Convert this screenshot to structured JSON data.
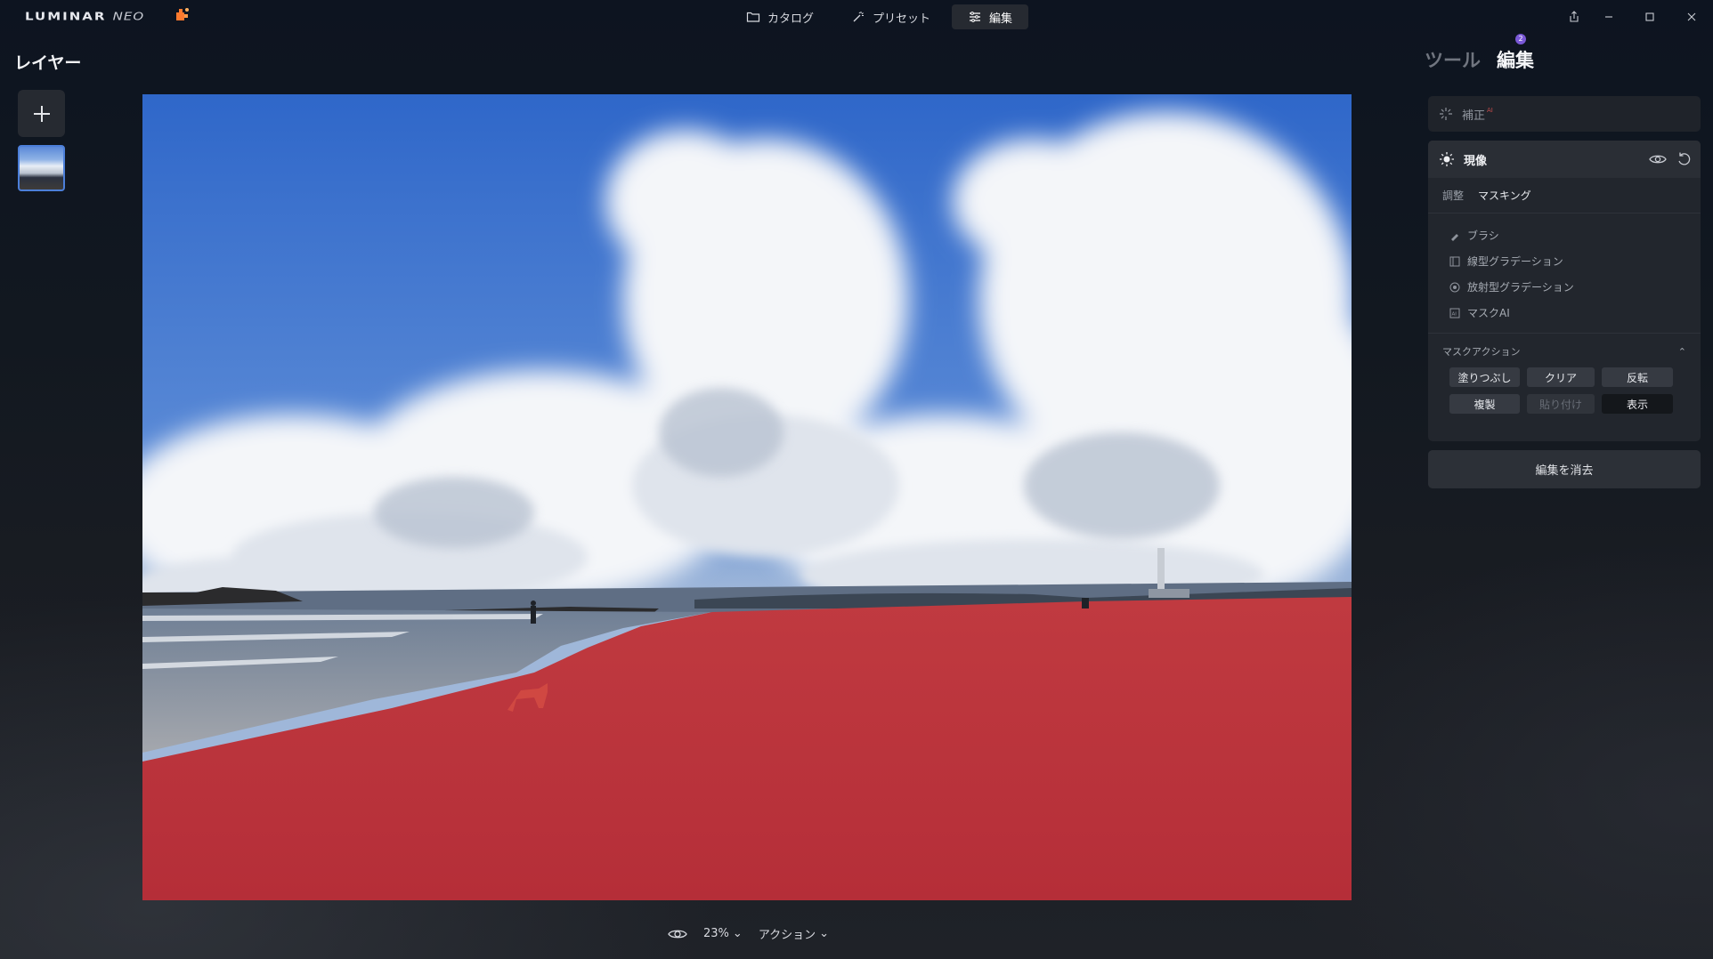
{
  "app": {
    "logo_text": "LUMINAR",
    "logo_suffix": "NEO"
  },
  "topnav": {
    "catalog": "カタログ",
    "presets": "プリセット",
    "edit": "編集"
  },
  "left": {
    "title": "レイヤー"
  },
  "right": {
    "tab_tools": "ツール",
    "tab_edit": "編集",
    "edit_badge": "2",
    "enhance_label": "補正",
    "enhance_ai": "AI",
    "develop_title": "現像",
    "subtabs": [
      "調整",
      "マスキング"
    ],
    "mask_tools": [
      "ブラシ",
      "線型グラデーション",
      "放射型グラデーション",
      "マスクAI"
    ],
    "mask_actions_title": "マスクアクション",
    "mask_actions": [
      "塗りつぶし",
      "クリア",
      "反転",
      "複製",
      "貼り付け",
      "表示"
    ],
    "clear_edits": "編集を消去"
  },
  "bottom": {
    "zoom": "23%",
    "actions": "アクション"
  },
  "colors": {
    "accent_blue": "#4c7fd9",
    "badge_purple": "#7a58d6",
    "mask_red": "#c8323a"
  }
}
